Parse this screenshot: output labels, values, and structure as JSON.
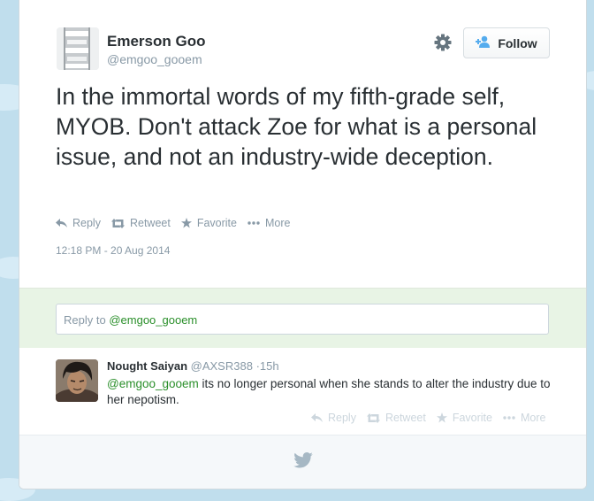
{
  "tweet": {
    "author_name": "Emerson Goo",
    "author_handle": "@emgoo_gooem",
    "text": "In the immortal words of my fifth-grade self, MYOB. Don't attack Zoe for what is a personal issue, and not an industry-wide deception.",
    "timestamp": "12:18 PM - 20 Aug 2014",
    "follow_label": "Follow",
    "actions": {
      "reply": "Reply",
      "retweet": "Retweet",
      "favorite": "Favorite",
      "more": "More"
    }
  },
  "reply_box": {
    "prefix": "Reply to",
    "mention": "@emgoo_gooem"
  },
  "reply": {
    "author_name": "Nought Saiyan",
    "author_handle": "@AXSR388",
    "separator": "·",
    "time": "15h",
    "mention": "@emgoo_gooem",
    "text": " its no longer personal when she stands to alter the industry due to her nepotism.",
    "actions": {
      "reply": "Reply",
      "retweet": "Retweet",
      "favorite": "Favorite",
      "more": "More"
    }
  },
  "colors": {
    "accent_green": "#2a8f2a",
    "muted": "#8899a6",
    "background": "#c0deed"
  },
  "icons": [
    "gear-icon",
    "add-user-icon",
    "reply-icon",
    "retweet-icon",
    "star-icon",
    "more-dots-icon",
    "twitter-bird-icon"
  ]
}
